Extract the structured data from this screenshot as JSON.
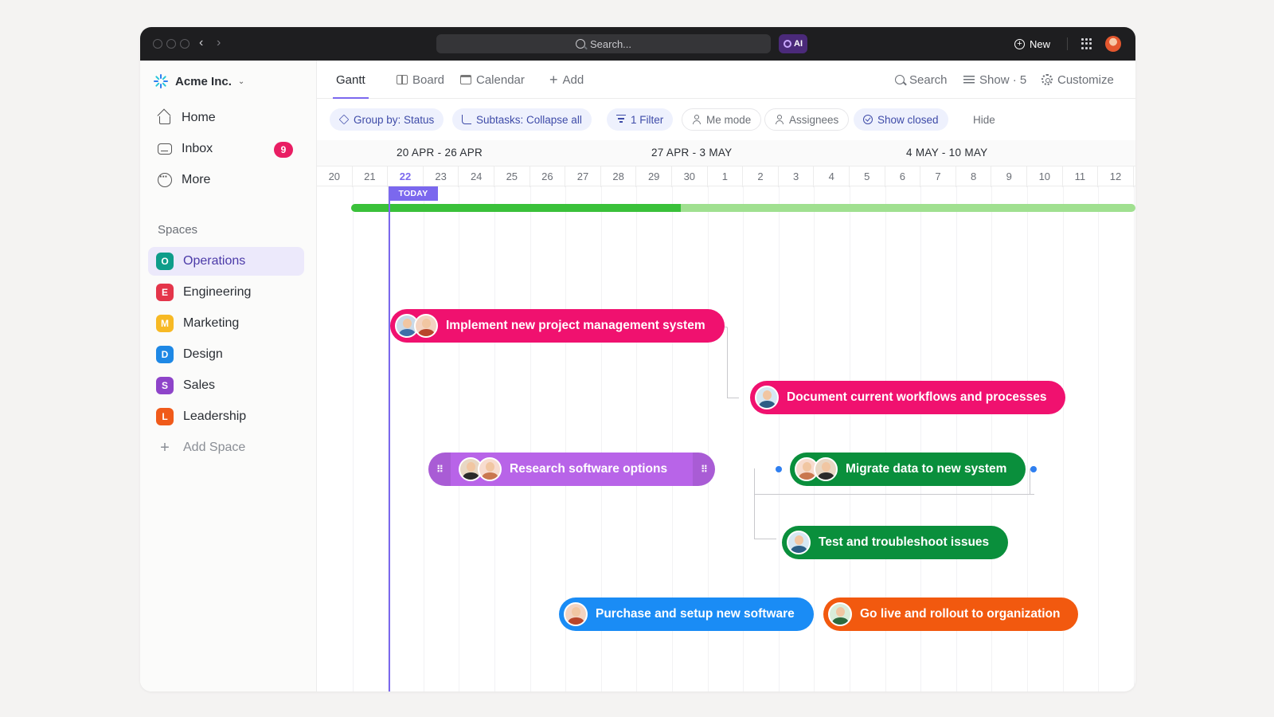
{
  "titlebar": {
    "search_placeholder": "Search...",
    "ai_label": "AI",
    "new_label": "New"
  },
  "sidebar": {
    "workspace": "Acme Inc.",
    "nav": [
      {
        "label": "Home",
        "icon": "home-icon"
      },
      {
        "label": "Inbox",
        "icon": "inbox-icon",
        "badge": "9"
      },
      {
        "label": "More",
        "icon": "more-icon"
      }
    ],
    "spaces_title": "Spaces",
    "spaces": [
      {
        "letter": "O",
        "label": "Operations",
        "color": "#0f9d8a",
        "active": true
      },
      {
        "letter": "E",
        "label": "Engineering",
        "color": "#e4354a"
      },
      {
        "letter": "M",
        "label": "Marketing",
        "color": "#f7b924"
      },
      {
        "letter": "D",
        "label": "Design",
        "color": "#1e88e5"
      },
      {
        "letter": "S",
        "label": "Sales",
        "color": "#8e44c9"
      },
      {
        "letter": "L",
        "label": "Leadership",
        "color": "#f05a1a"
      }
    ],
    "add_space": "Add Space"
  },
  "toolbar": {
    "tabs": [
      "Gantt",
      "Board",
      "Calendar"
    ],
    "add": "Add",
    "search": "Search",
    "show": "Show · 5",
    "customize": "Customize"
  },
  "filters": {
    "group_by": "Group by: Status",
    "subtasks": "Subtasks: Collapse all",
    "filter": "1 Filter",
    "me_mode": "Me mode",
    "assignees": "Assignees",
    "show_closed": "Show closed",
    "hide": "Hide"
  },
  "gantt": {
    "weeks": [
      "20 APR - 26 APR",
      "27 APR - 3 MAY",
      "4 MAY - 10 MAY"
    ],
    "days": [
      "20",
      "21",
      "22",
      "23",
      "24",
      "25",
      "26",
      "27",
      "28",
      "29",
      "30",
      "1",
      "2",
      "3",
      "4",
      "5",
      "6",
      "7",
      "8",
      "9",
      "10",
      "11",
      "12"
    ],
    "today_index": 2,
    "today_label": "TODAY",
    "progress": 0.42,
    "tasks": [
      {
        "label": "Implement new project management system",
        "color": "#f0116f",
        "avatars": [
          "a1",
          "a2"
        ]
      },
      {
        "label": "Document current workflows and processes",
        "color": "#f0116f",
        "avatars": [
          "a3"
        ]
      },
      {
        "label": "Research software options",
        "color": "#b864e8",
        "avatars": [
          "a4",
          "a5"
        ]
      },
      {
        "label": "Migrate data to new system",
        "color": "#0a8f3c",
        "avatars": [
          "a5",
          "a4"
        ]
      },
      {
        "label": "Test and troubleshoot issues",
        "color": "#0a8f3c",
        "avatars": [
          "a3"
        ]
      },
      {
        "label": "Purchase and setup new software",
        "color": "#1a8cf5",
        "avatars": [
          "a2"
        ]
      },
      {
        "label": "Go live and rollout to organization",
        "color": "#f2590f",
        "avatars": [
          "a6"
        ]
      }
    ]
  }
}
